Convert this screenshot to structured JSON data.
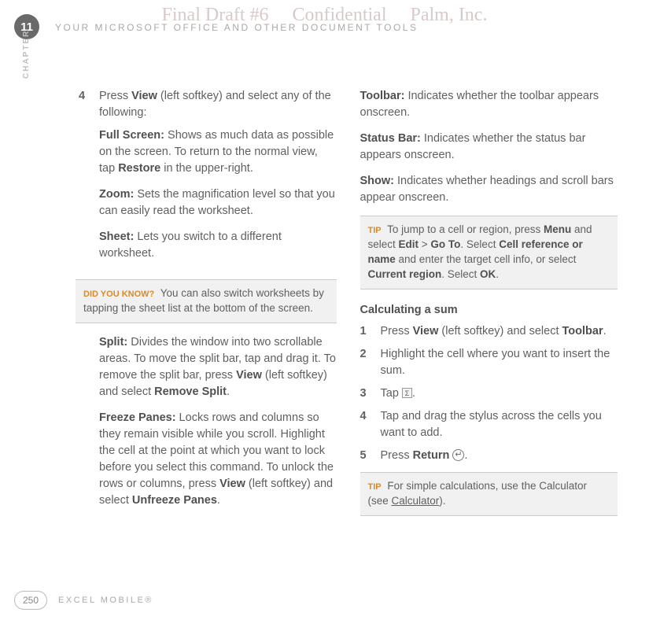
{
  "watermark": "Final Draft #6     Confidential     Palm, Inc.",
  "chapter": {
    "label": "CHAPTER",
    "number": "11",
    "header": "YOUR MICROSOFT OFFICE AND OTHER DOCUMENT TOOLS"
  },
  "left": {
    "step4_num": "4",
    "step4_a": "Press ",
    "step4_b": "View",
    "step4_c": " (left softkey) and select any of the following:",
    "fullscreen_label": "Full Screen:",
    "fullscreen_a": " Shows as much data as possible on the screen. To return to the normal view, tap ",
    "fullscreen_b": "Restore",
    "fullscreen_c": " in the upper-right.",
    "zoom_label": "Zoom:",
    "zoom_body": " Sets the magnification level so that you can easily read the worksheet.",
    "sheet_label": "Sheet:",
    "sheet_body": " Lets you switch to a different worksheet.",
    "dyk_tag": "DID YOU KNOW?",
    "dyk_body": " You can also switch worksheets by tapping the sheet list at the bottom of the screen.",
    "split_label": "Split:",
    "split_a": " Divides the window into two scrollable areas. To move the split bar, tap and drag it. To remove the split bar, press ",
    "split_b": "View",
    "split_c": " (left softkey) and select ",
    "split_d": "Remove Split",
    "split_e": ".",
    "freeze_label": "Freeze Panes:",
    "freeze_a": " Locks rows and columns so they remain visible while you scroll. Highlight the cell at the point at which you want to lock before you select this command. To unlock the rows or columns, press ",
    "freeze_b": "View",
    "freeze_c": " (left softkey) and select ",
    "freeze_d": "Unfreeze Panes",
    "freeze_e": "."
  },
  "right": {
    "toolbar_label": "Toolbar:",
    "toolbar_body": " Indicates whether the toolbar appears onscreen.",
    "status_label": "Status Bar:",
    "status_body": " Indicates whether the status bar appears onscreen.",
    "show_label": "Show:",
    "show_body": " Indicates whether headings and scroll bars appear onscreen.",
    "tip1_tag": "TIP",
    "tip1_a": " To jump to a cell or region, press ",
    "tip1_b": "Menu",
    "tip1_c": " and select ",
    "tip1_d": "Edit",
    "tip1_e": " > ",
    "tip1_f": "Go To",
    "tip1_g": ". Select ",
    "tip1_h": "Cell reference or name",
    "tip1_i": " and enter the target cell info, or select ",
    "tip1_j": "Current region",
    "tip1_k": ". Select ",
    "tip1_l": "OK",
    "tip1_m": ".",
    "calc_heading": "Calculating a sum",
    "s1_num": "1",
    "s1_a": "Press ",
    "s1_b": "View",
    "s1_c": " (left softkey) and select ",
    "s1_d": "Toolbar",
    "s1_e": ".",
    "s2_num": "2",
    "s2": "Highlight the cell where you want to insert the sum.",
    "s3_num": "3",
    "s3_a": "Tap ",
    "s3_b": ".",
    "s4_num": "4",
    "s4": "Tap and drag the stylus across the cells you want to add.",
    "s5_num": "5",
    "s5_a": "Press ",
    "s5_b": "Return",
    "s5_c": " ",
    "s5_d": ".",
    "tip2_tag": "TIP",
    "tip2_a": " For simple calculations, use the Calculator (see ",
    "tip2_b": "Calculator",
    "tip2_c": ")."
  },
  "footer": {
    "page": "250",
    "title": "EXCEL MOBILE®"
  }
}
